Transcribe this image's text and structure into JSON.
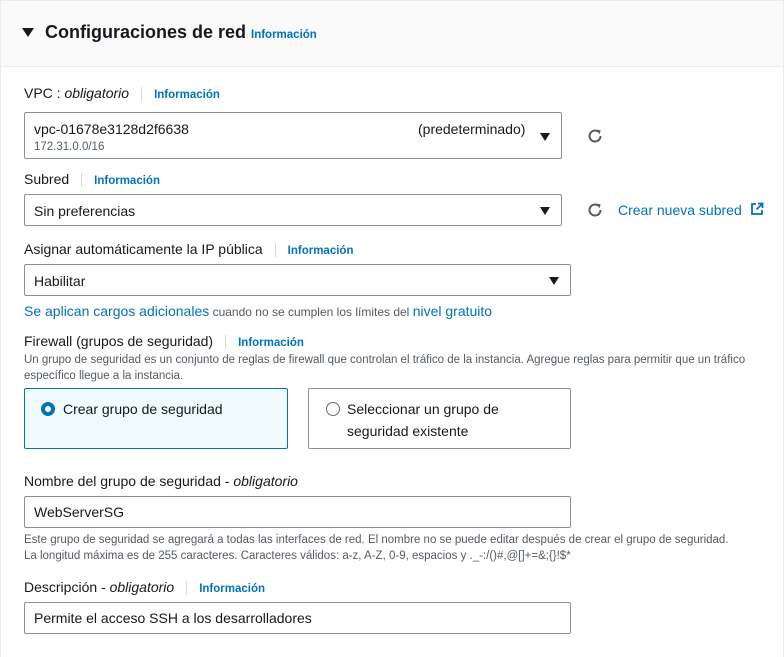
{
  "header": {
    "title": "Configuraciones de red",
    "info": "Información"
  },
  "vpc": {
    "label": "VPC",
    "separator": " : ",
    "required": "obligatorio",
    "info": "Información",
    "value": "vpc-01678e3128d2f6638",
    "cidr": "172.31.0.0/16",
    "tag": "(predeterminado)"
  },
  "subnet": {
    "label": "Subred",
    "info": "Información",
    "value": "Sin preferencias",
    "create_link": "Crear nueva subred"
  },
  "public_ip": {
    "label": "Asignar automáticamente la IP pública",
    "info": "Información",
    "value": "Habilitar",
    "charges_link": "Se aplican cargos adicionales",
    "charges_text": " cuando no se cumplen los límites del ",
    "free_tier_link": "nivel gratuito"
  },
  "firewall": {
    "label": "Firewall (grupos de seguridad)",
    "info": "Información",
    "description": "Un grupo de seguridad es un conjunto de reglas de firewall que controlan el tráfico de la instancia. Agregue reglas para permitir que un tráfico específico llegue a la instancia.",
    "options": [
      {
        "label": "Crear grupo de seguridad",
        "selected": true
      },
      {
        "label": "Seleccionar un grupo de seguridad existente",
        "selected": false
      }
    ]
  },
  "sg_name": {
    "label": "Nombre del grupo de seguridad",
    "separator": " - ",
    "required": "obligatorio",
    "value": "WebServerSG",
    "help": "Este grupo de seguridad se agregará a todas las interfaces de red. El nombre no se puede editar después de crear el grupo de seguridad. La longitud máxima es de 255 caracteres. Caracteres válidos: a-z, A-Z, 0-9, espacios y ._-:/()#,@[]+=&;{}!$*"
  },
  "description": {
    "label": "Descripción",
    "separator": " - ",
    "required": "obligatorio",
    "info": "Información",
    "value": "Permite el acceso SSH a los desarrolladores"
  },
  "icons": {
    "caret": "caret-down-icon",
    "refresh": "refresh-icon",
    "external": "external-link-icon",
    "dropdown": "chevron-down-icon"
  },
  "colors": {
    "link": "#0073bb",
    "selected_bg": "#f1faff",
    "text": "#16191f",
    "muted": "#545b64"
  }
}
